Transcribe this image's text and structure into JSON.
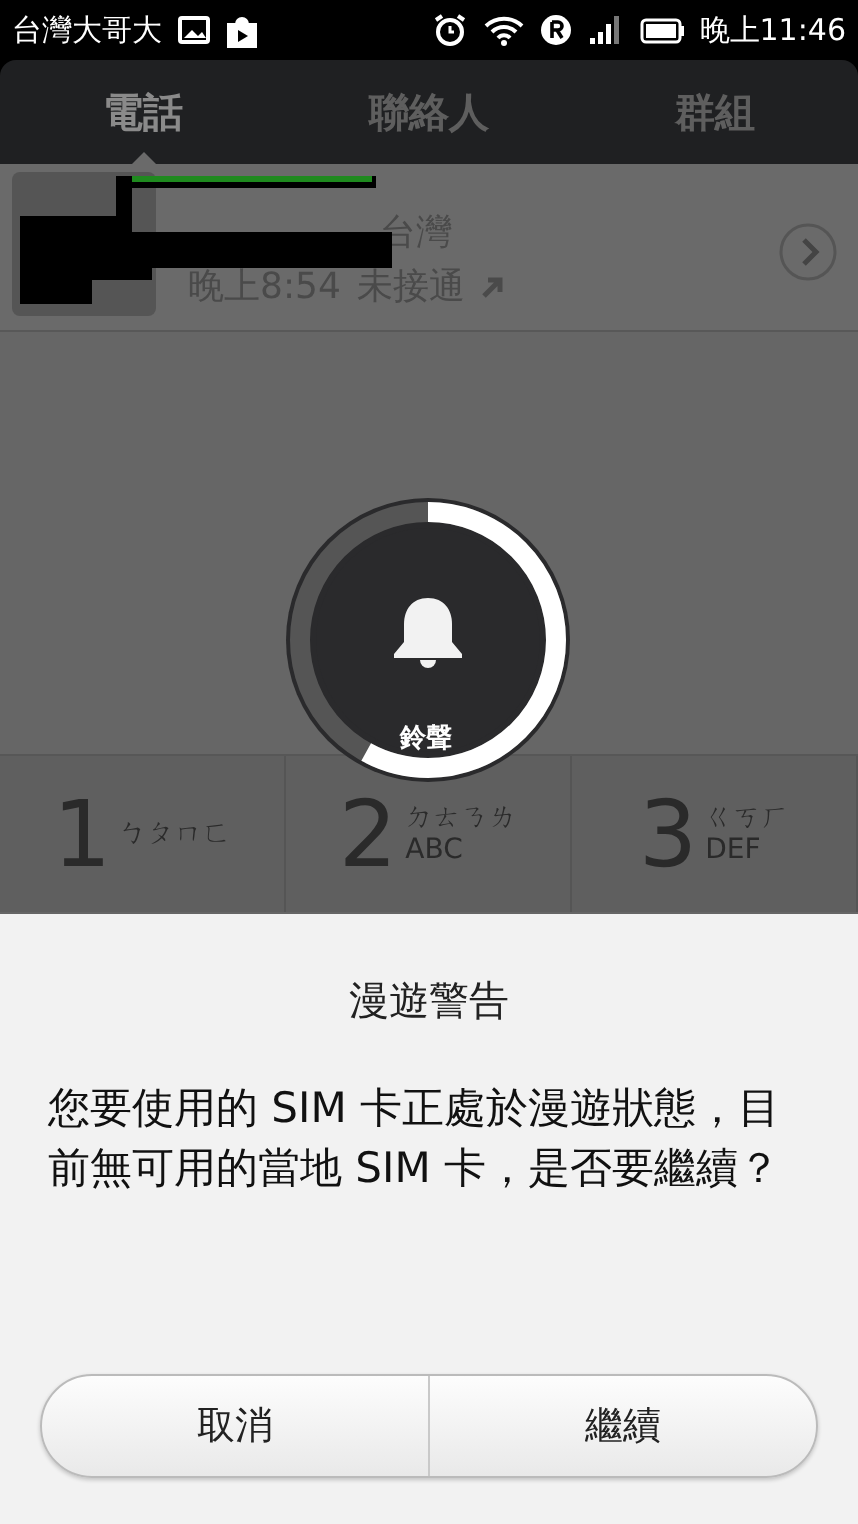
{
  "status_bar": {
    "carrier": "台灣大哥大",
    "time": "晚上11:46"
  },
  "tabs": [
    {
      "label": "電話",
      "selected": true
    },
    {
      "label": "聯絡人",
      "selected": false
    },
    {
      "label": "群組",
      "selected": false
    }
  ],
  "call_log": [
    {
      "location": "台灣",
      "time": "晚上8:54",
      "status": "未接通",
      "redacted": true
    }
  ],
  "volume": {
    "label": "鈴聲",
    "level": 0.58
  },
  "keypad": [
    {
      "digit": "1",
      "letters": [
        "ㄅㄆㄇㄈ"
      ]
    },
    {
      "digit": "2",
      "letters": [
        "ㄉㄊㄋㄌ",
        "ABC"
      ]
    },
    {
      "digit": "3",
      "letters": [
        "ㄍㄎㄏ",
        "DEF"
      ]
    }
  ],
  "dialog": {
    "title": "漫遊警告",
    "message": "您要使用的 SIM 卡正處於漫遊狀態，目前無可用的當地 SIM 卡，是否要繼續？",
    "buttons": [
      "取消",
      "繼續"
    ]
  }
}
